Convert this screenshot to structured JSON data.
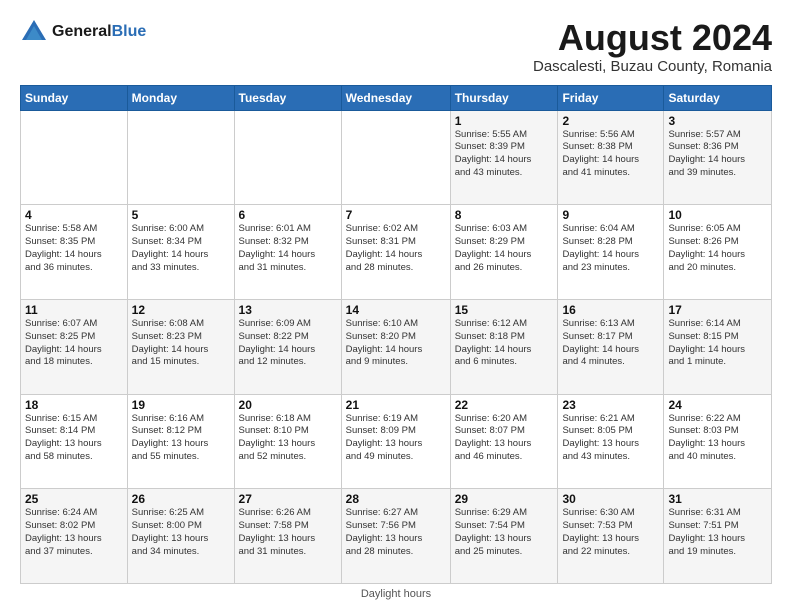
{
  "logo": {
    "text_general": "General",
    "text_blue": "Blue"
  },
  "header": {
    "title": "August 2024",
    "subtitle": "Dascalesti, Buzau County, Romania"
  },
  "weekdays": [
    "Sunday",
    "Monday",
    "Tuesday",
    "Wednesday",
    "Thursday",
    "Friday",
    "Saturday"
  ],
  "footer": {
    "daylight_label": "Daylight hours"
  },
  "weeks": [
    [
      {
        "day": "",
        "info": ""
      },
      {
        "day": "",
        "info": ""
      },
      {
        "day": "",
        "info": ""
      },
      {
        "day": "",
        "info": ""
      },
      {
        "day": "1",
        "info": "Sunrise: 5:55 AM\nSunset: 8:39 PM\nDaylight: 14 hours\nand 43 minutes."
      },
      {
        "day": "2",
        "info": "Sunrise: 5:56 AM\nSunset: 8:38 PM\nDaylight: 14 hours\nand 41 minutes."
      },
      {
        "day": "3",
        "info": "Sunrise: 5:57 AM\nSunset: 8:36 PM\nDaylight: 14 hours\nand 39 minutes."
      }
    ],
    [
      {
        "day": "4",
        "info": "Sunrise: 5:58 AM\nSunset: 8:35 PM\nDaylight: 14 hours\nand 36 minutes."
      },
      {
        "day": "5",
        "info": "Sunrise: 6:00 AM\nSunset: 8:34 PM\nDaylight: 14 hours\nand 33 minutes."
      },
      {
        "day": "6",
        "info": "Sunrise: 6:01 AM\nSunset: 8:32 PM\nDaylight: 14 hours\nand 31 minutes."
      },
      {
        "day": "7",
        "info": "Sunrise: 6:02 AM\nSunset: 8:31 PM\nDaylight: 14 hours\nand 28 minutes."
      },
      {
        "day": "8",
        "info": "Sunrise: 6:03 AM\nSunset: 8:29 PM\nDaylight: 14 hours\nand 26 minutes."
      },
      {
        "day": "9",
        "info": "Sunrise: 6:04 AM\nSunset: 8:28 PM\nDaylight: 14 hours\nand 23 minutes."
      },
      {
        "day": "10",
        "info": "Sunrise: 6:05 AM\nSunset: 8:26 PM\nDaylight: 14 hours\nand 20 minutes."
      }
    ],
    [
      {
        "day": "11",
        "info": "Sunrise: 6:07 AM\nSunset: 8:25 PM\nDaylight: 14 hours\nand 18 minutes."
      },
      {
        "day": "12",
        "info": "Sunrise: 6:08 AM\nSunset: 8:23 PM\nDaylight: 14 hours\nand 15 minutes."
      },
      {
        "day": "13",
        "info": "Sunrise: 6:09 AM\nSunset: 8:22 PM\nDaylight: 14 hours\nand 12 minutes."
      },
      {
        "day": "14",
        "info": "Sunrise: 6:10 AM\nSunset: 8:20 PM\nDaylight: 14 hours\nand 9 minutes."
      },
      {
        "day": "15",
        "info": "Sunrise: 6:12 AM\nSunset: 8:18 PM\nDaylight: 14 hours\nand 6 minutes."
      },
      {
        "day": "16",
        "info": "Sunrise: 6:13 AM\nSunset: 8:17 PM\nDaylight: 14 hours\nand 4 minutes."
      },
      {
        "day": "17",
        "info": "Sunrise: 6:14 AM\nSunset: 8:15 PM\nDaylight: 14 hours\nand 1 minute."
      }
    ],
    [
      {
        "day": "18",
        "info": "Sunrise: 6:15 AM\nSunset: 8:14 PM\nDaylight: 13 hours\nand 58 minutes."
      },
      {
        "day": "19",
        "info": "Sunrise: 6:16 AM\nSunset: 8:12 PM\nDaylight: 13 hours\nand 55 minutes."
      },
      {
        "day": "20",
        "info": "Sunrise: 6:18 AM\nSunset: 8:10 PM\nDaylight: 13 hours\nand 52 minutes."
      },
      {
        "day": "21",
        "info": "Sunrise: 6:19 AM\nSunset: 8:09 PM\nDaylight: 13 hours\nand 49 minutes."
      },
      {
        "day": "22",
        "info": "Sunrise: 6:20 AM\nSunset: 8:07 PM\nDaylight: 13 hours\nand 46 minutes."
      },
      {
        "day": "23",
        "info": "Sunrise: 6:21 AM\nSunset: 8:05 PM\nDaylight: 13 hours\nand 43 minutes."
      },
      {
        "day": "24",
        "info": "Sunrise: 6:22 AM\nSunset: 8:03 PM\nDaylight: 13 hours\nand 40 minutes."
      }
    ],
    [
      {
        "day": "25",
        "info": "Sunrise: 6:24 AM\nSunset: 8:02 PM\nDaylight: 13 hours\nand 37 minutes."
      },
      {
        "day": "26",
        "info": "Sunrise: 6:25 AM\nSunset: 8:00 PM\nDaylight: 13 hours\nand 34 minutes."
      },
      {
        "day": "27",
        "info": "Sunrise: 6:26 AM\nSunset: 7:58 PM\nDaylight: 13 hours\nand 31 minutes."
      },
      {
        "day": "28",
        "info": "Sunrise: 6:27 AM\nSunset: 7:56 PM\nDaylight: 13 hours\nand 28 minutes."
      },
      {
        "day": "29",
        "info": "Sunrise: 6:29 AM\nSunset: 7:54 PM\nDaylight: 13 hours\nand 25 minutes."
      },
      {
        "day": "30",
        "info": "Sunrise: 6:30 AM\nSunset: 7:53 PM\nDaylight: 13 hours\nand 22 minutes."
      },
      {
        "day": "31",
        "info": "Sunrise: 6:31 AM\nSunset: 7:51 PM\nDaylight: 13 hours\nand 19 minutes."
      }
    ]
  ]
}
